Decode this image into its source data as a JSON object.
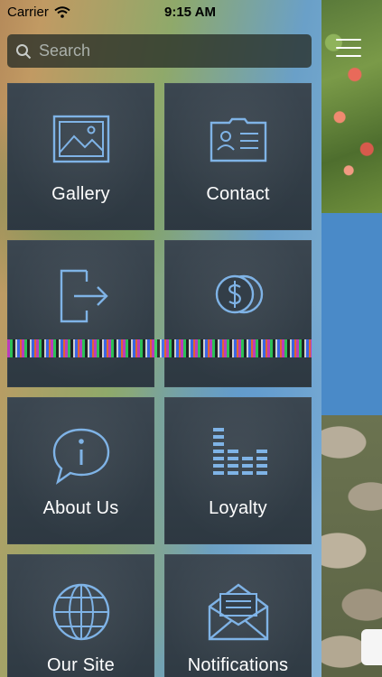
{
  "status_bar": {
    "carrier": "Carrier",
    "time": "9:15 AM"
  },
  "search": {
    "placeholder": "Search"
  },
  "tiles": [
    {
      "label": "Gallery",
      "icon": "gallery-icon"
    },
    {
      "label": "Contact",
      "icon": "contact-card-icon"
    },
    {
      "label": "",
      "icon": "exit-arrow-icon"
    },
    {
      "label": "",
      "icon": "dollar-coin-icon"
    },
    {
      "label": "About Us",
      "icon": "info-bubble-icon"
    },
    {
      "label": "Loyalty",
      "icon": "loyalty-bars-icon"
    },
    {
      "label": "Our Site",
      "icon": "globe-icon"
    },
    {
      "label": "Notifications",
      "icon": "envelope-icon"
    }
  ],
  "colors": {
    "icon_stroke": "#7fb3e6",
    "tile_bg": "#333e48",
    "peek_blue": "#4a8ac8"
  }
}
